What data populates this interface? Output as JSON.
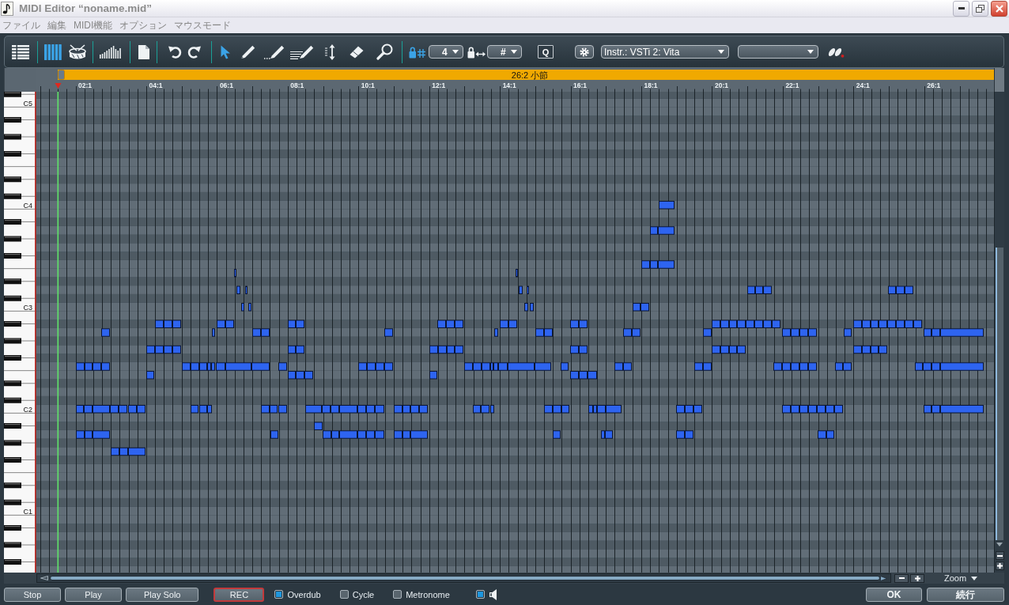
{
  "window": {
    "title": "MIDI Editor “noname.mid”"
  },
  "menu": [
    "ファイル",
    "編集",
    "MIDI機能",
    "オプション",
    "マウスモード"
  ],
  "toolbar": {
    "views": [
      {
        "selected": false
      },
      {
        "selected": true
      },
      {
        "selected": false
      },
      {
        "selected": false
      }
    ],
    "tools": [
      {
        "selected": true
      },
      {
        "selected": false
      },
      {
        "selected": false
      },
      {
        "selected": false
      },
      {
        "selected": false
      },
      {
        "selected": false
      },
      {
        "selected": false
      }
    ],
    "snap": {
      "locked": true,
      "value": "4"
    },
    "key": {
      "locked": false,
      "value": "#"
    },
    "quantize_label": "Q",
    "instrument": "Instr.: VSTi 2: Vita"
  },
  "ruler": {
    "range_label": "26:2 小節",
    "bar_labels": [
      "02:1",
      "04:1",
      "06:1",
      "08:1",
      "10:1",
      "12:1",
      "14:1",
      "16:1",
      "18:1",
      "20:1",
      "22:1",
      "24:1",
      "26:1"
    ]
  },
  "keyboard": {
    "labels": [
      "C5",
      "C4",
      "C3",
      "C2",
      "C1"
    ]
  },
  "zoom": {
    "label": "Zoom"
  },
  "transport": [
    {
      "label": "Stop",
      "kind": "normal"
    },
    {
      "label": "Play",
      "kind": "normal"
    },
    {
      "label": "Play Solo",
      "kind": "normal"
    },
    {
      "label": "REC",
      "kind": "record"
    }
  ],
  "options": [
    {
      "label": "Overdub",
      "checked": true
    },
    {
      "label": "Cycle",
      "checked": false
    },
    {
      "label": "Metronome",
      "checked": false
    }
  ],
  "speaker": {
    "checked": true
  },
  "dialog_buttons": [
    "OK",
    "続行"
  ]
}
